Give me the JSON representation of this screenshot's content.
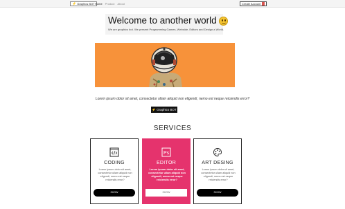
{
  "navbar": {
    "brand": "Graphics BOT",
    "links": [
      "Home",
      "Product",
      "About"
    ],
    "create_label": "Create Account"
  },
  "hero": {
    "title": "Welcome to another world",
    "subtitle": "We are graphics bot. We present Programming Games, Webside, Editors and Design a World."
  },
  "banner": {
    "image": "astronaut-illustration",
    "background": "#f7923a"
  },
  "intro": {
    "text": "Lorem ipsum dolor sit amet, consectetur ullam aliquid non eligendi, nemo est neque reiciendis error?",
    "button": "Graphics BOT"
  },
  "services": {
    "heading": "SERVICES",
    "cards": [
      {
        "icon": "code-icon",
        "title": "CODING",
        "text": "Lorem ipsum dolor sit amet, consectetur ullam aliquid non eligendi, nemo est neque reiciendis error?",
        "button": "SHOW"
      },
      {
        "icon": "photoshop-icon",
        "title": "EDITOR",
        "text": "Lorem ipsum dolor sit amet, consectetur ullam aliquid non eligendi, nemo est neque reiciendis error?",
        "button": "SHOW"
      },
      {
        "icon": "palette-icon",
        "title": "ART DESING",
        "text": "Lorem ipsum dolor sit amet, consectetur ullam aliquid non eligendi, nemo est neque reiciendis error?",
        "button": "SHOW"
      }
    ]
  },
  "colors": {
    "accent": "#e5336d",
    "banner": "#f7923a",
    "dark": "#111111"
  }
}
